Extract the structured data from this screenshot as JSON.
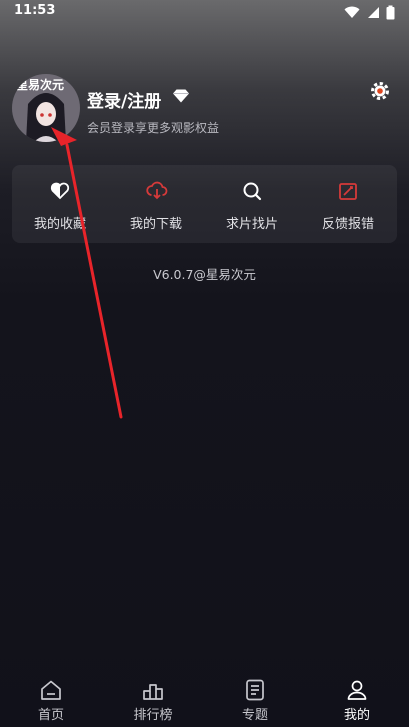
{
  "status": {
    "time": "11:53"
  },
  "profile": {
    "avatar_text": "星易次元",
    "login_label": "登录/注册",
    "subtitle": "会员登录享更多观影权益"
  },
  "quick_actions": [
    {
      "label": "我的收藏",
      "icon": "heart-icon"
    },
    {
      "label": "我的下载",
      "icon": "cloud-download-icon"
    },
    {
      "label": "求片找片",
      "icon": "search-icon"
    },
    {
      "label": "反馈报错",
      "icon": "feedback-icon"
    }
  ],
  "version": "V6.0.7@星易次元",
  "tabs": [
    {
      "label": "首页",
      "icon": "home-icon"
    },
    {
      "label": "排行榜",
      "icon": "ranking-icon"
    },
    {
      "label": "专题",
      "icon": "topic-icon"
    },
    {
      "label": "我的",
      "icon": "profile-icon",
      "active": true
    }
  ],
  "colors": {
    "accent": "#d63a3a",
    "background": "#11111a",
    "annotation_arrow": "#e8242a"
  }
}
